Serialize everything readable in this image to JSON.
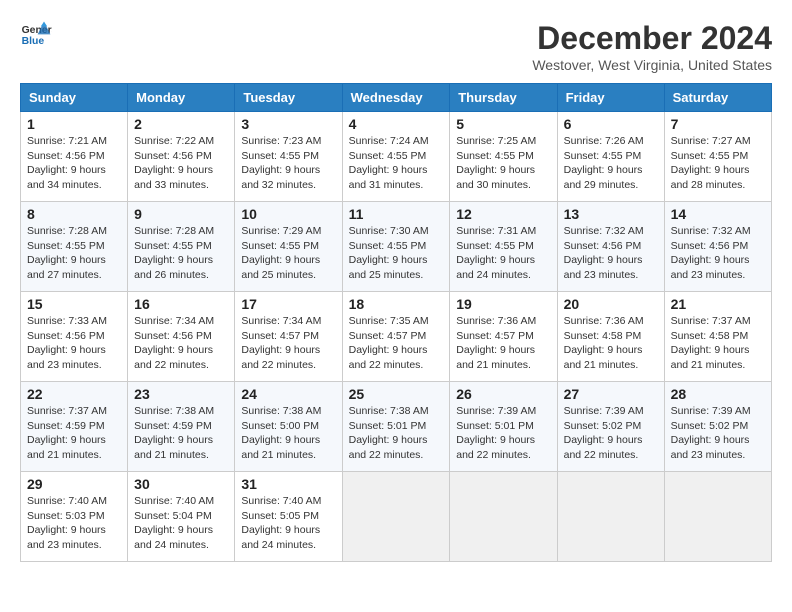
{
  "logo": {
    "line1": "General",
    "line2": "Blue"
  },
  "title": "December 2024",
  "location": "Westover, West Virginia, United States",
  "weekdays": [
    "Sunday",
    "Monday",
    "Tuesday",
    "Wednesday",
    "Thursday",
    "Friday",
    "Saturday"
  ],
  "weeks": [
    [
      {
        "day": "1",
        "sunrise": "7:21 AM",
        "sunset": "4:56 PM",
        "daylight": "9 hours and 34 minutes."
      },
      {
        "day": "2",
        "sunrise": "7:22 AM",
        "sunset": "4:56 PM",
        "daylight": "9 hours and 33 minutes."
      },
      {
        "day": "3",
        "sunrise": "7:23 AM",
        "sunset": "4:55 PM",
        "daylight": "9 hours and 32 minutes."
      },
      {
        "day": "4",
        "sunrise": "7:24 AM",
        "sunset": "4:55 PM",
        "daylight": "9 hours and 31 minutes."
      },
      {
        "day": "5",
        "sunrise": "7:25 AM",
        "sunset": "4:55 PM",
        "daylight": "9 hours and 30 minutes."
      },
      {
        "day": "6",
        "sunrise": "7:26 AM",
        "sunset": "4:55 PM",
        "daylight": "9 hours and 29 minutes."
      },
      {
        "day": "7",
        "sunrise": "7:27 AM",
        "sunset": "4:55 PM",
        "daylight": "9 hours and 28 minutes."
      }
    ],
    [
      {
        "day": "8",
        "sunrise": "7:28 AM",
        "sunset": "4:55 PM",
        "daylight": "9 hours and 27 minutes."
      },
      {
        "day": "9",
        "sunrise": "7:28 AM",
        "sunset": "4:55 PM",
        "daylight": "9 hours and 26 minutes."
      },
      {
        "day": "10",
        "sunrise": "7:29 AM",
        "sunset": "4:55 PM",
        "daylight": "9 hours and 25 minutes."
      },
      {
        "day": "11",
        "sunrise": "7:30 AM",
        "sunset": "4:55 PM",
        "daylight": "9 hours and 25 minutes."
      },
      {
        "day": "12",
        "sunrise": "7:31 AM",
        "sunset": "4:55 PM",
        "daylight": "9 hours and 24 minutes."
      },
      {
        "day": "13",
        "sunrise": "7:32 AM",
        "sunset": "4:56 PM",
        "daylight": "9 hours and 23 minutes."
      },
      {
        "day": "14",
        "sunrise": "7:32 AM",
        "sunset": "4:56 PM",
        "daylight": "9 hours and 23 minutes."
      }
    ],
    [
      {
        "day": "15",
        "sunrise": "7:33 AM",
        "sunset": "4:56 PM",
        "daylight": "9 hours and 23 minutes."
      },
      {
        "day": "16",
        "sunrise": "7:34 AM",
        "sunset": "4:56 PM",
        "daylight": "9 hours and 22 minutes."
      },
      {
        "day": "17",
        "sunrise": "7:34 AM",
        "sunset": "4:57 PM",
        "daylight": "9 hours and 22 minutes."
      },
      {
        "day": "18",
        "sunrise": "7:35 AM",
        "sunset": "4:57 PM",
        "daylight": "9 hours and 22 minutes."
      },
      {
        "day": "19",
        "sunrise": "7:36 AM",
        "sunset": "4:57 PM",
        "daylight": "9 hours and 21 minutes."
      },
      {
        "day": "20",
        "sunrise": "7:36 AM",
        "sunset": "4:58 PM",
        "daylight": "9 hours and 21 minutes."
      },
      {
        "day": "21",
        "sunrise": "7:37 AM",
        "sunset": "4:58 PM",
        "daylight": "9 hours and 21 minutes."
      }
    ],
    [
      {
        "day": "22",
        "sunrise": "7:37 AM",
        "sunset": "4:59 PM",
        "daylight": "9 hours and 21 minutes."
      },
      {
        "day": "23",
        "sunrise": "7:38 AM",
        "sunset": "4:59 PM",
        "daylight": "9 hours and 21 minutes."
      },
      {
        "day": "24",
        "sunrise": "7:38 AM",
        "sunset": "5:00 PM",
        "daylight": "9 hours and 21 minutes."
      },
      {
        "day": "25",
        "sunrise": "7:38 AM",
        "sunset": "5:01 PM",
        "daylight": "9 hours and 22 minutes."
      },
      {
        "day": "26",
        "sunrise": "7:39 AM",
        "sunset": "5:01 PM",
        "daylight": "9 hours and 22 minutes."
      },
      {
        "day": "27",
        "sunrise": "7:39 AM",
        "sunset": "5:02 PM",
        "daylight": "9 hours and 22 minutes."
      },
      {
        "day": "28",
        "sunrise": "7:39 AM",
        "sunset": "5:02 PM",
        "daylight": "9 hours and 23 minutes."
      }
    ],
    [
      {
        "day": "29",
        "sunrise": "7:40 AM",
        "sunset": "5:03 PM",
        "daylight": "9 hours and 23 minutes."
      },
      {
        "day": "30",
        "sunrise": "7:40 AM",
        "sunset": "5:04 PM",
        "daylight": "9 hours and 24 minutes."
      },
      {
        "day": "31",
        "sunrise": "7:40 AM",
        "sunset": "5:05 PM",
        "daylight": "9 hours and 24 minutes."
      },
      null,
      null,
      null,
      null
    ]
  ]
}
